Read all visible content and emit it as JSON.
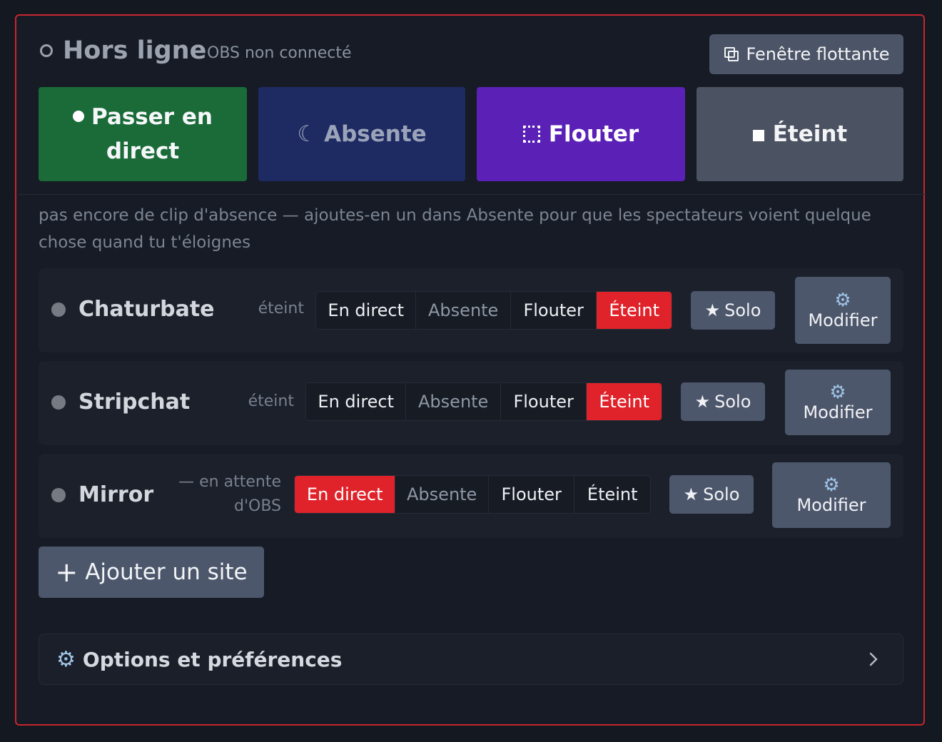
{
  "header": {
    "status_title": "Hors ligne",
    "status_sub": "OBS non connecté",
    "float_button": "Fenêtre flottante"
  },
  "modes": {
    "live_line1": "Passer en",
    "live_line2": "direct",
    "away": "Absente",
    "blur": "Flouter",
    "off": "Éteint"
  },
  "notice": "pas encore de clip d'absence — ajoutes-en un dans Absente pour que les spectateurs voient quelque chose quand tu t'éloignes",
  "sites": [
    {
      "name": "Chaturbate",
      "state": "éteint",
      "options": [
        "En direct",
        "Absente",
        "Flouter",
        "Éteint"
      ],
      "active": "Éteint",
      "solo": "Solo",
      "edit": "Modifier"
    },
    {
      "name": "Stripchat",
      "state": "éteint",
      "options": [
        "En direct",
        "Absente",
        "Flouter",
        "Éteint"
      ],
      "active": "Éteint",
      "solo": "Solo",
      "edit": "Modifier"
    },
    {
      "name": "Mirror",
      "state_line1": "— en attente",
      "state_line2": "d'OBS",
      "options": [
        "En direct",
        "Absente",
        "Flouter",
        "Éteint"
      ],
      "active": "En direct",
      "solo": "Solo",
      "edit": "Modifier"
    }
  ],
  "add_site": "Ajouter un site",
  "options_section": "Options et préférences",
  "colors": {
    "accent_red": "#e0222a",
    "live_green": "#1a6b37",
    "away_navy": "#1e2b63",
    "blur_purple": "#5b21b6",
    "off_gray": "#4b5261",
    "button_slate": "#4d576c"
  }
}
